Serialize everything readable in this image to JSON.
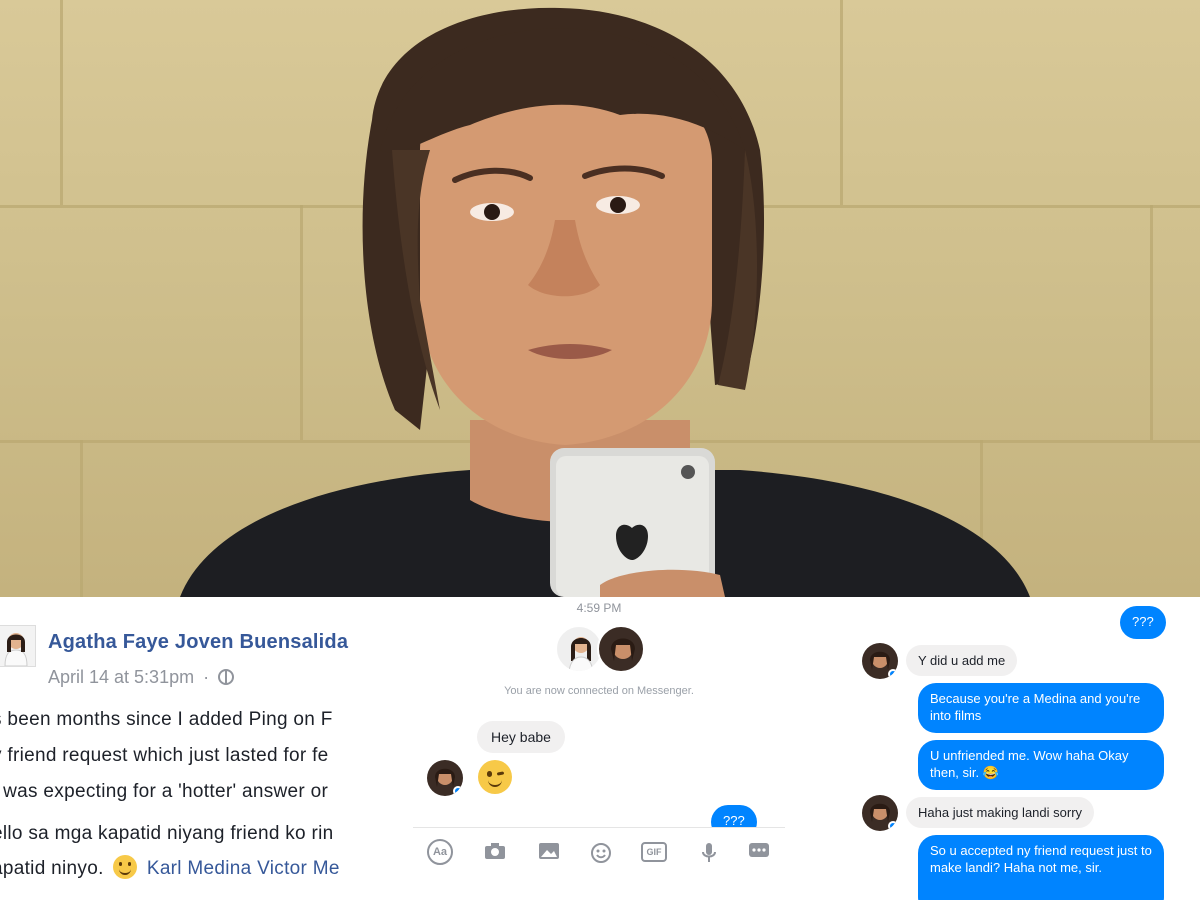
{
  "fb_post": {
    "author": "Agatha Faye Joven Buensalida",
    "date": "April 14 at 5:31pm",
    "separator": "·",
    "lines": [
      "s been months since I added Ping on F",
      "y friend request which just lasted for fe",
      "I was expecting for a 'hotter' answer or",
      "ello sa mga kapatid niyang friend ko rin"
    ],
    "last_line_prefix": "apatid ninyo.",
    "mention_1": "Karl Medina",
    "mention_2_tail": "Victor Me"
  },
  "messenger_1": {
    "timestamp": "4:59 PM",
    "connected_text": "You are now connected on Messenger.",
    "messages": [
      {
        "from": "them",
        "text": "Hey babe"
      },
      {
        "from": "me",
        "text": "???"
      }
    ],
    "toolbar": [
      "aa-icon",
      "camera-icon",
      "image-icon",
      "emoji-icon",
      "gif-icon",
      "microphone-icon",
      "more-icon"
    ],
    "toolbar_labels": {
      "aa": "Aa",
      "gif": "GIF"
    }
  },
  "messenger_2": {
    "messages": [
      {
        "from": "me",
        "text": "???"
      },
      {
        "from": "them",
        "text": "Y did u add me"
      },
      {
        "from": "me",
        "text": "Because you're a Medina and you're into films"
      },
      {
        "from": "me",
        "text": "U unfriended me.  Wow haha Okay then, sir. 😂"
      },
      {
        "from": "them",
        "text": "Haha just making landi sorry"
      },
      {
        "from": "me",
        "text": "So u accepted ny friend request just to make landi? Haha not me, sir."
      }
    ]
  },
  "colors": {
    "messenger_blue": "#0084ff",
    "facebook_link": "#365899",
    "incoming_bubble": "#f1f0f0"
  }
}
